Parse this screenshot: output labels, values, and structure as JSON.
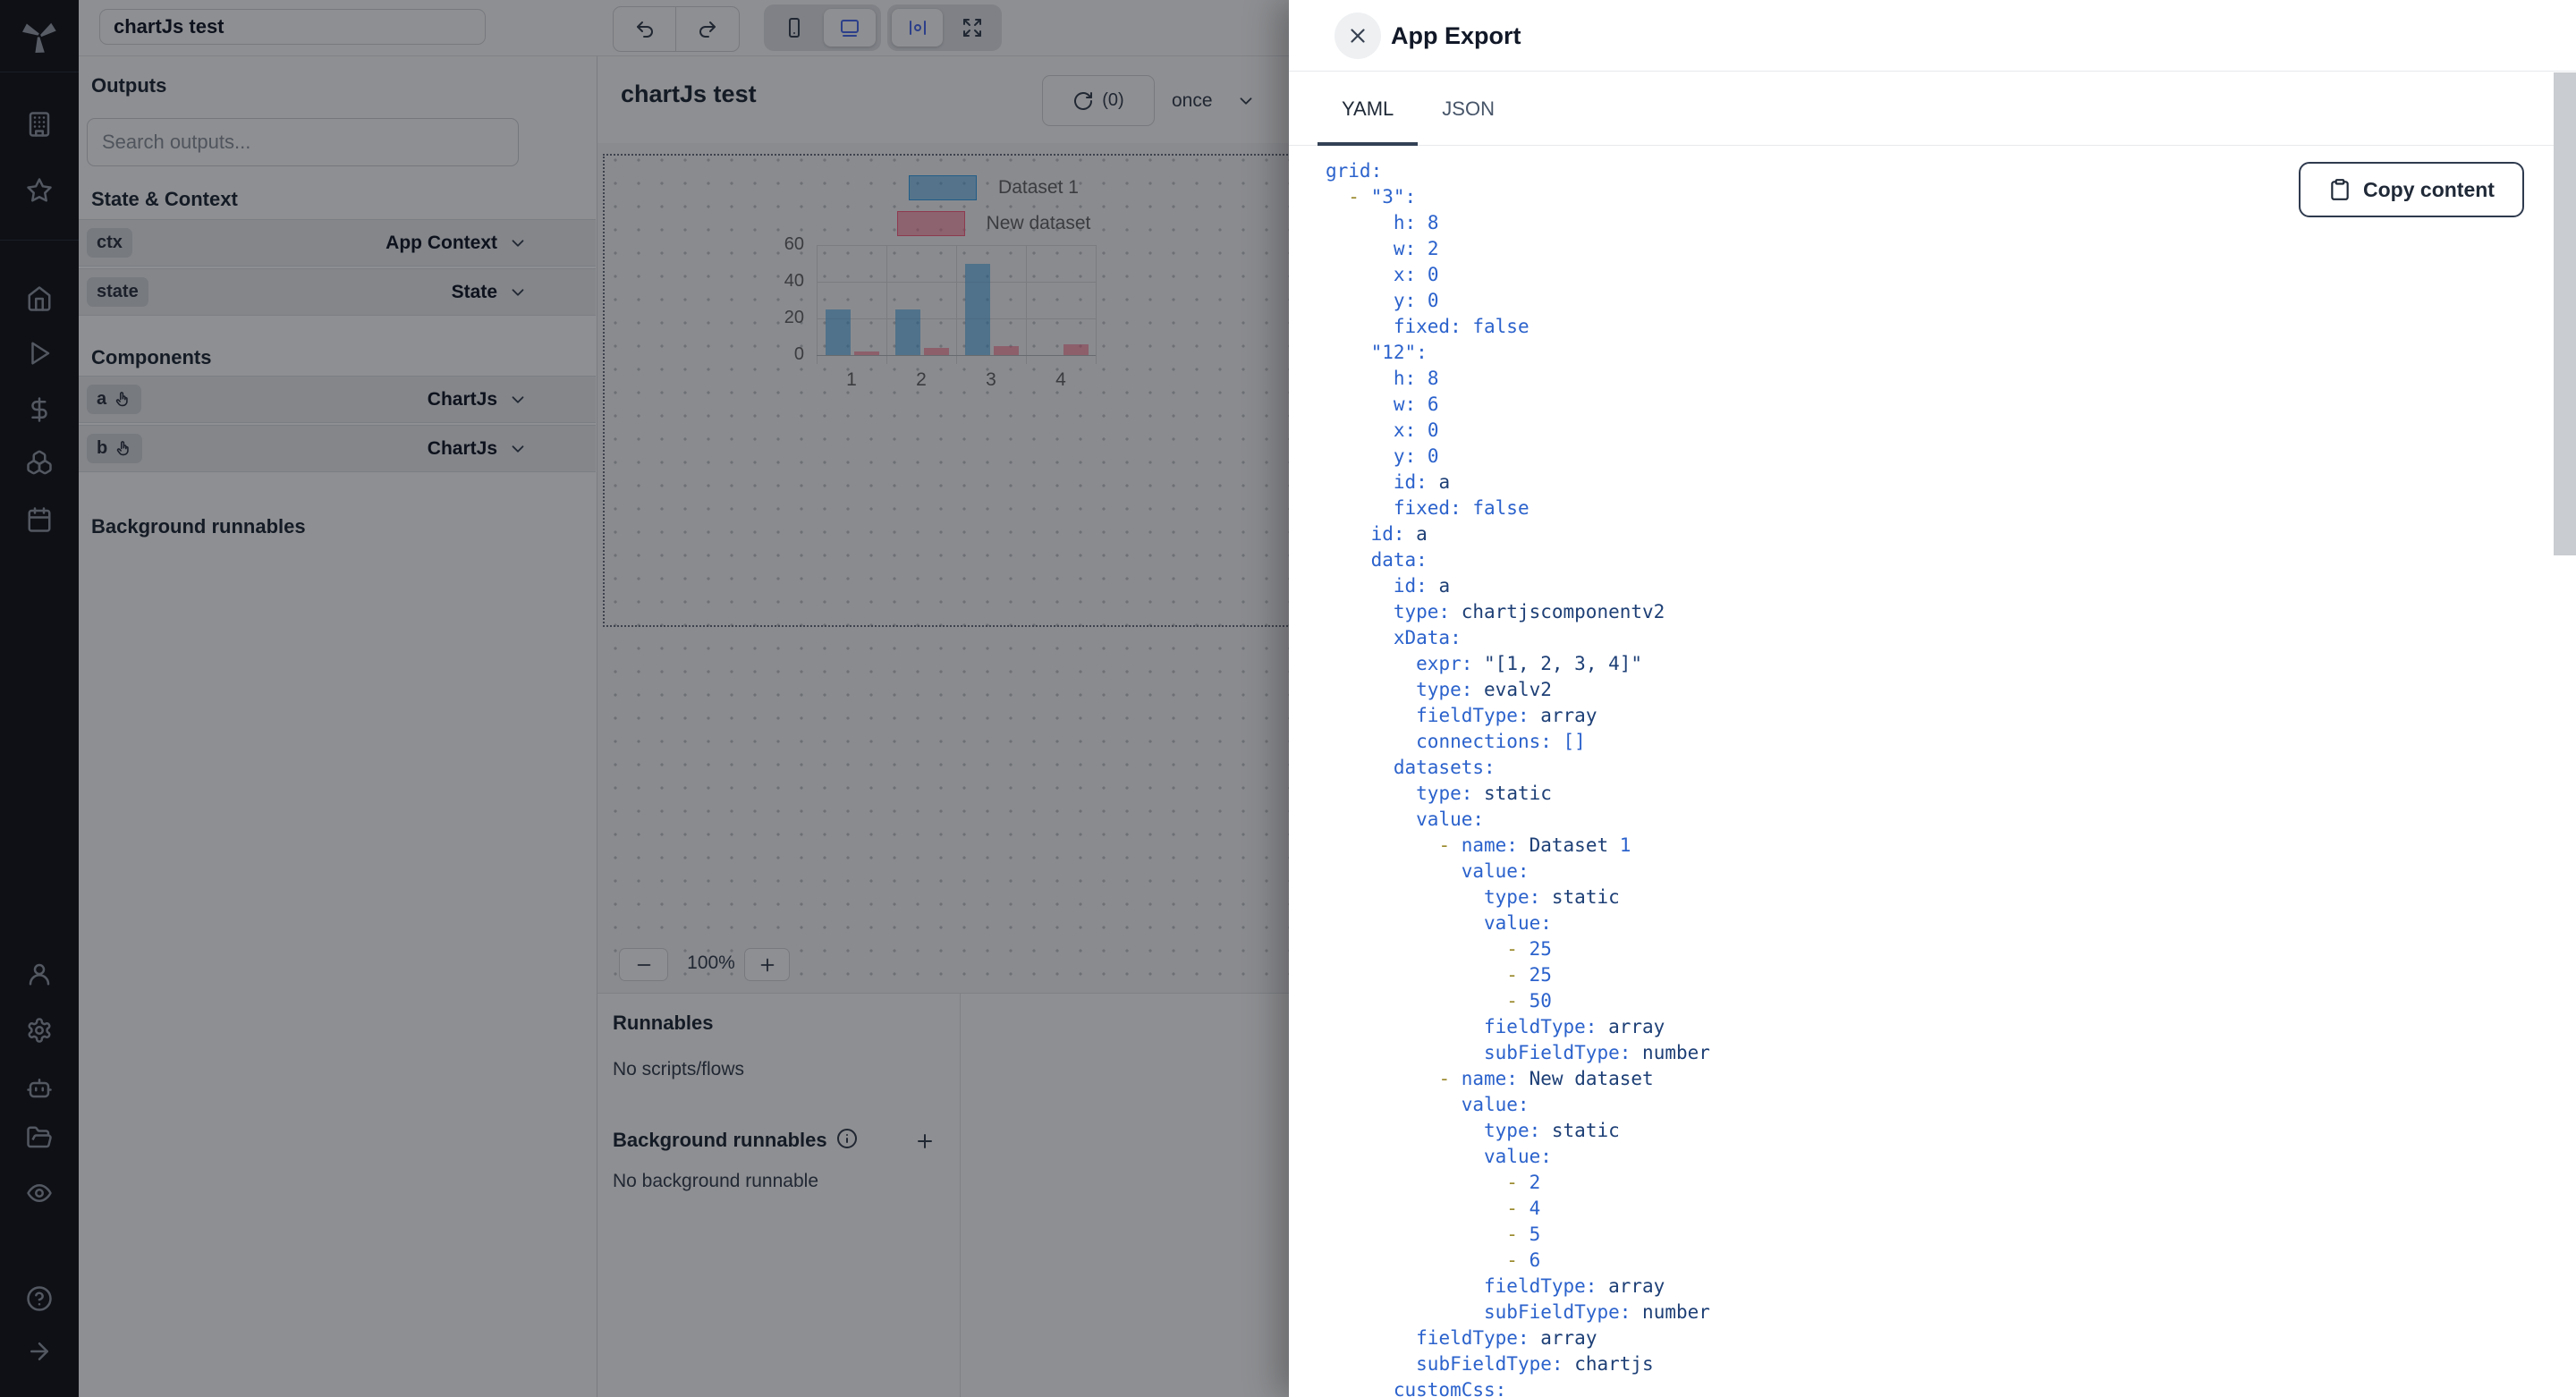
{
  "topbar": {
    "title_value": "chartJs test"
  },
  "sidebar": {
    "icons": [
      "windmill-logo",
      "building",
      "star",
      "home",
      "play",
      "dollar-sign",
      "boxes",
      "calendar",
      "user",
      "settings",
      "bot",
      "folder-open",
      "eye",
      "help-circle",
      "arrow-right"
    ]
  },
  "left_panel": {
    "outputs_heading": "Outputs",
    "search_placeholder": "Search outputs...",
    "state_context_heading": "State & Context",
    "components_heading": "Components",
    "background_heading": "Background runnables",
    "state_rows": [
      {
        "badge": "ctx",
        "label": "App Context",
        "hand": false
      },
      {
        "badge": "state",
        "label": "State",
        "hand": false
      }
    ],
    "component_rows": [
      {
        "badge": "a",
        "label": "ChartJs",
        "hand": true
      },
      {
        "badge": "b",
        "label": "ChartJs",
        "hand": true
      }
    ]
  },
  "canvas": {
    "title": "chartJs test",
    "runs_count": "(0)",
    "refresh_mode": "once",
    "zoom_level": "100%",
    "zoom_minus": "−",
    "zoom_plus": "+"
  },
  "runnables": {
    "heading": "Runnables",
    "empty": "No scripts/flows",
    "background_heading": "Background runnables",
    "background_empty": "No background runnable"
  },
  "drawer": {
    "title": "App Export",
    "tabs": [
      {
        "label": "YAML",
        "active": true
      },
      {
        "label": "JSON",
        "active": false
      }
    ],
    "copy_label": "Copy content",
    "yaml_lines": [
      "grid:",
      "  - \"3\":",
      "      h: 8",
      "      w: 2",
      "      x: 0",
      "      y: 0",
      "      fixed: false",
      "    \"12\":",
      "      h: 8",
      "      w: 6",
      "      x: 0",
      "      y: 0",
      "      id: a",
      "      fixed: false",
      "    id: a",
      "    data:",
      "      id: a",
      "      type: chartjscomponentv2",
      "      xData:",
      "        expr: \"[1, 2, 3, 4]\"",
      "        type: evalv2",
      "        fieldType: array",
      "        connections: []",
      "      datasets:",
      "        type: static",
      "        value:",
      "          - name: Dataset 1",
      "            value:",
      "              type: static",
      "              value:",
      "                - 25",
      "                - 25",
      "                - 50",
      "              fieldType: array",
      "              subFieldType: number",
      "          - name: New dataset",
      "            value:",
      "              type: static",
      "              value:",
      "                - 2",
      "                - 4",
      "                - 5",
      "                - 6",
      "              fieldType: array",
      "              subFieldType: number",
      "        fieldType: array",
      "        subFieldType: chartjs",
      "      customCss:"
    ]
  },
  "chart_data": {
    "type": "bar",
    "categories": [
      "1",
      "2",
      "3",
      "4"
    ],
    "series": [
      {
        "name": "Dataset 1",
        "color": "#36A2EB",
        "values": [
          25,
          25,
          50,
          0
        ]
      },
      {
        "name": "New dataset",
        "color": "#FF6384",
        "values": [
          2,
          4,
          5,
          6
        ]
      }
    ],
    "yticks": [
      0,
      20,
      40,
      60
    ],
    "ylim": [
      0,
      60
    ],
    "legend_position": "top",
    "grid": true
  },
  "colors": {
    "accent_blue": "#4a6cf0",
    "chart_blue": "#36A2EB",
    "chart_red": "#FF6384",
    "yaml_key": "#2b62cc",
    "yaml_string": "#1d3f76",
    "yaml_dash": "#9b8b2f"
  }
}
